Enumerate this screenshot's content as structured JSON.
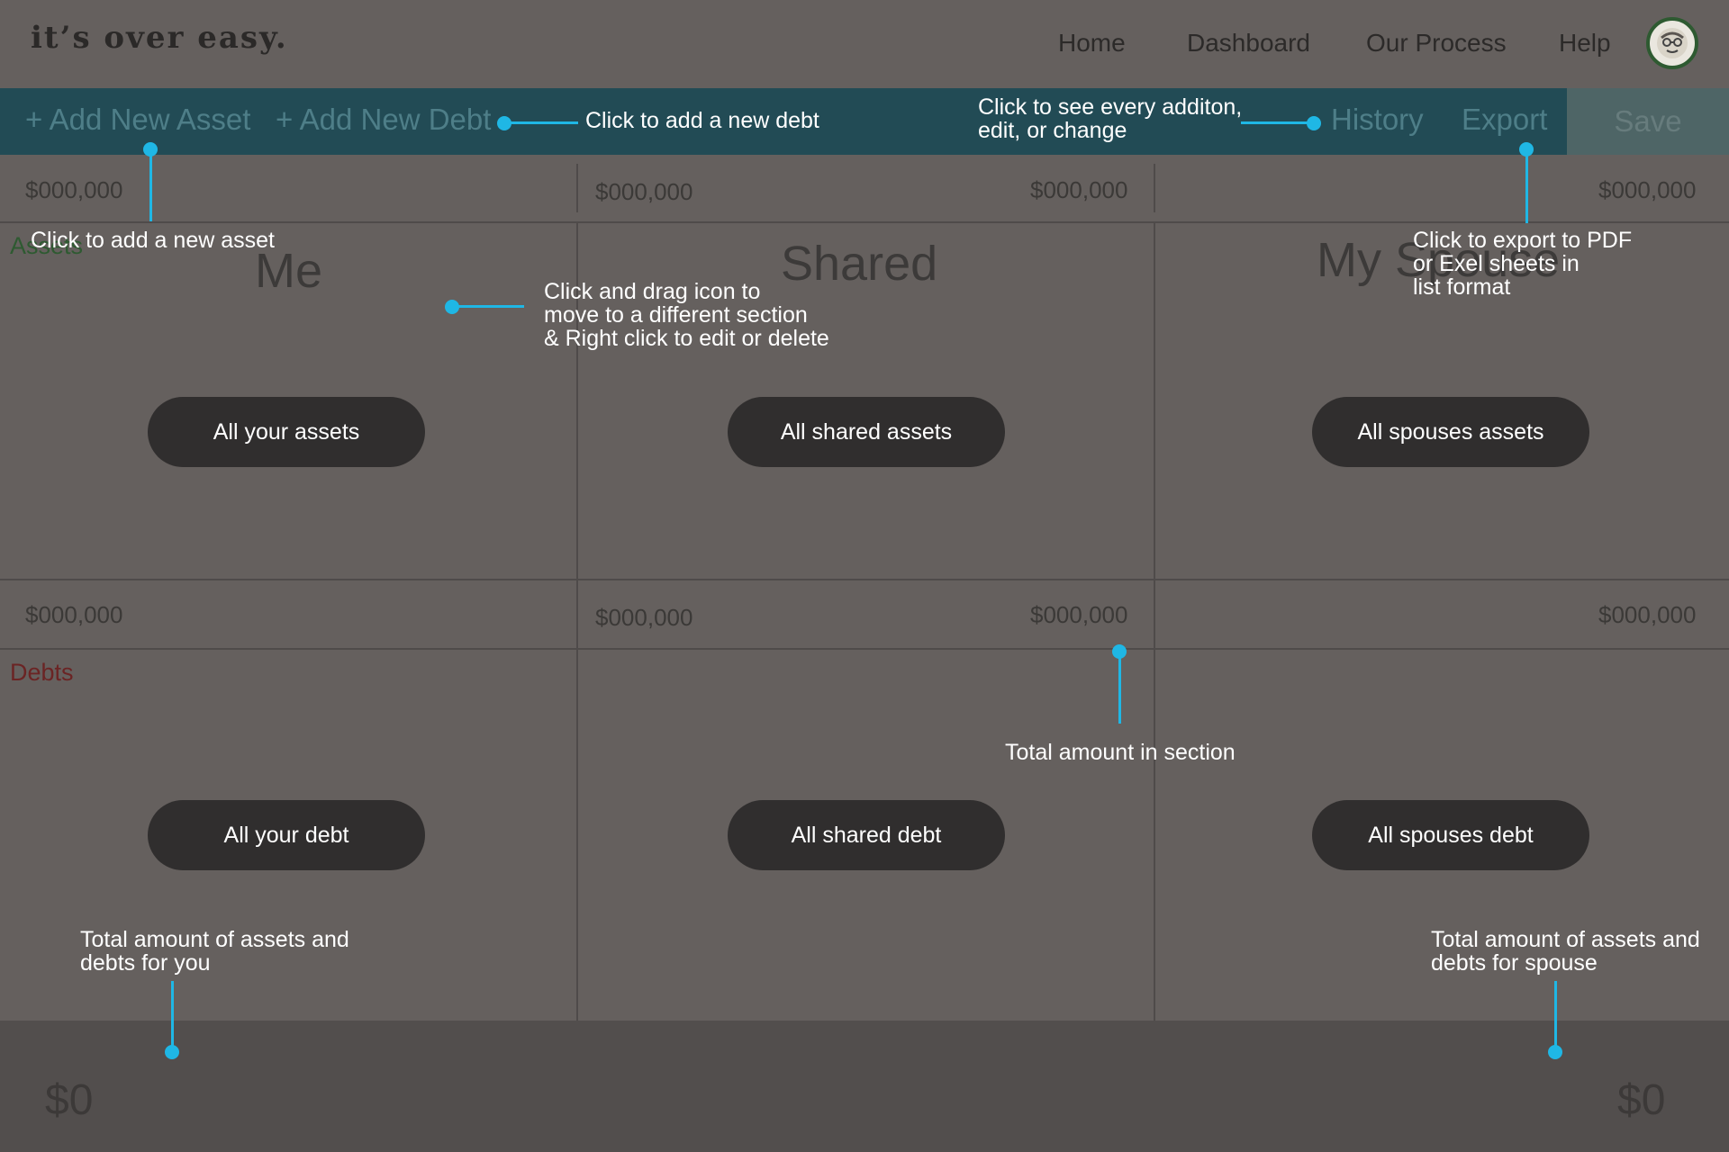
{
  "brand": "it’s over easy.",
  "nav": {
    "home": "Home",
    "dashboard": "Dashboard",
    "process": "Our Process",
    "help": "Help"
  },
  "toolbar": {
    "add_asset": "+ Add New Asset",
    "add_debt": "+ Add New Debt",
    "history": "History",
    "export": "Export",
    "save": "Save"
  },
  "assets_row": {
    "me_total": "$000,000",
    "shared_left": "$000,000",
    "shared_right": "$000,000",
    "spouse_total": "$000,000",
    "label": "Assets"
  },
  "columns": {
    "me": "Me",
    "shared": "Shared",
    "spouse": "My Spouse"
  },
  "asset_pills": {
    "me": "All your assets",
    "shared": "All shared assets",
    "spouse": "All spouses assets"
  },
  "debts_row": {
    "me_total": "$000,000",
    "shared_left": "$000,000",
    "shared_right": "$000,000",
    "spouse_total": "$000,000",
    "label": "Debts"
  },
  "debt_pills": {
    "me": "All your debt",
    "shared": "All shared debt",
    "spouse": "All spouses debt"
  },
  "footer": {
    "me_total": "$0",
    "spouse_total": "$0"
  },
  "annotations": {
    "add_debt": "Click to add a new debt",
    "history_1": "Click to see every additon,",
    "history_2": "edit, or change",
    "add_asset": "Click to add a new asset",
    "drag_1": "Click and drag icon to",
    "drag_2": "move to a different section",
    "drag_3": "& Right click to edit or delete",
    "export_1": "Click to export to PDF",
    "export_2": "or Exel sheets in",
    "export_3": "list format",
    "section_total": "Total amount in section",
    "you_total_1": "Total amount of assets and",
    "you_total_2": "debts for you",
    "spouse_total_1": "Total amount of assets and",
    "spouse_total_2": "debts for spouse"
  },
  "colors": {
    "background": "#65605e",
    "toolbar": "#224b55",
    "annotation_accent": "#1fb7e5",
    "assets_label": "#2e5a31",
    "debts_label": "#6b2424"
  }
}
